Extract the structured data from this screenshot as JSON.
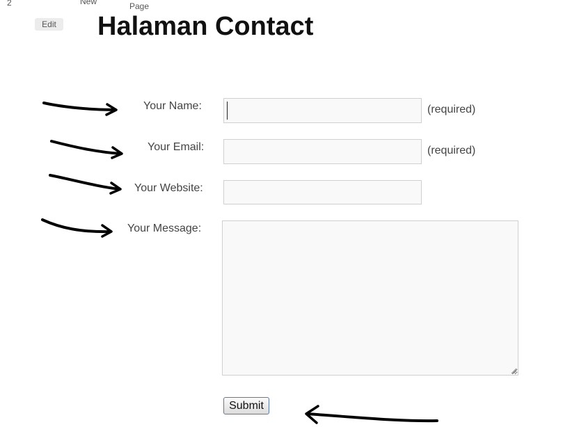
{
  "breadcrumb": {
    "number": "2",
    "new_label": "New",
    "page_label": "Page"
  },
  "edit_label": "Edit",
  "page_title": "Halaman Contact",
  "form": {
    "name_label": "Your Name:",
    "name_value": "",
    "name_note": "(required)",
    "email_label": "Your Email:",
    "email_value": "",
    "email_note": "(required)",
    "website_label": "Your Website:",
    "website_value": "",
    "message_label": "Your Message:",
    "message_value": "",
    "submit_label": "Submit"
  },
  "annotations": {
    "arrow_color": "#000000",
    "arrow_count": 5
  }
}
